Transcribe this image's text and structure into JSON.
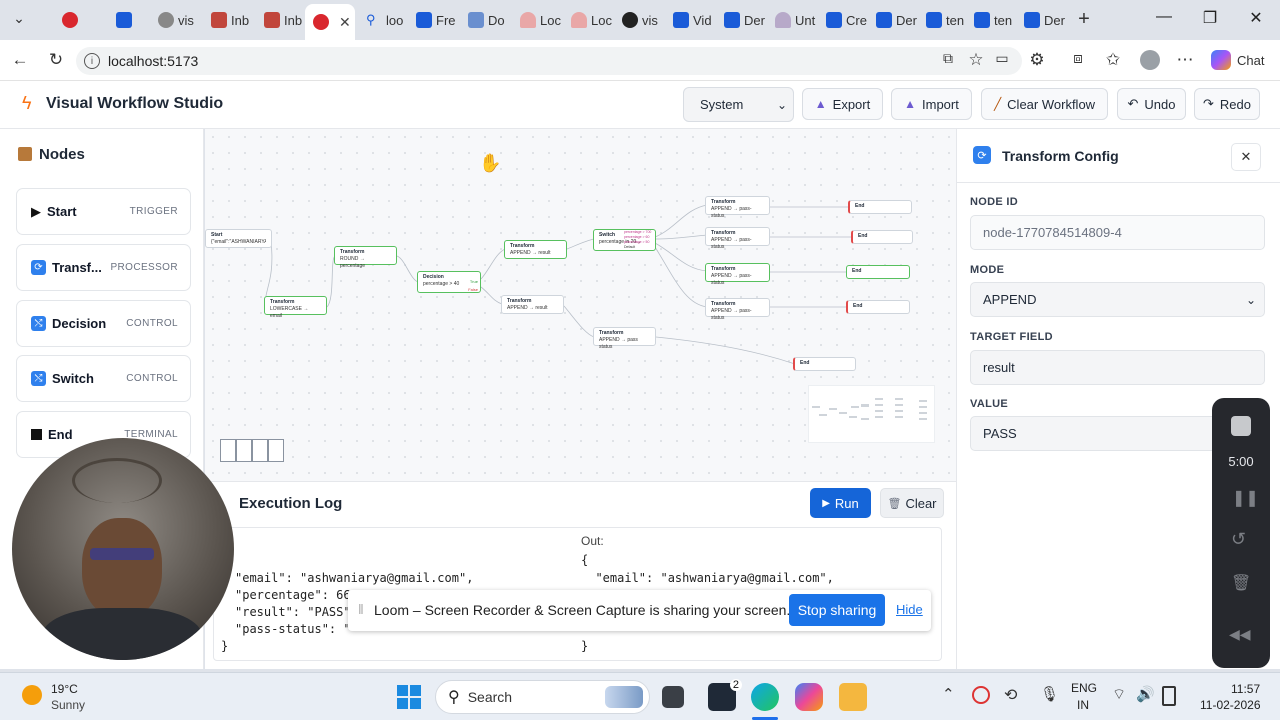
{
  "browser": {
    "tabs": [
      "vis",
      "Inb",
      "Inb",
      "",
      "loo",
      "Fre",
      "Do",
      "Loc",
      "Loc",
      "vis",
      "Vid",
      "Der",
      "Unt",
      "Cre",
      "Der",
      "ten",
      "ten",
      "Der"
    ],
    "url": "localhost:5173",
    "chat_label": "Chat"
  },
  "app": {
    "title": "Visual Workflow Studio",
    "mode_value": "System",
    "buttons": {
      "export": "Export",
      "import": "Import",
      "clear_workflow": "Clear Workflow",
      "undo": "Undo",
      "redo": "Redo"
    }
  },
  "sidebar": {
    "title": "Nodes",
    "items": [
      {
        "label": "Start",
        "category": "TRIGGER"
      },
      {
        "label": "Transf...",
        "category": "PROCESSOR"
      },
      {
        "label": "Decision",
        "category": "CONTROL"
      },
      {
        "label": "Switch",
        "category": "CONTROL"
      },
      {
        "label": "End",
        "category": "TERMINAL"
      }
    ]
  },
  "canvas": {
    "nodes": [
      {
        "title": "Start",
        "sub": "{\"email\":\"ASHWANIARYA@..."
      },
      {
        "title": "Transform",
        "sub": "LOWERCASE → email"
      },
      {
        "title": "Transform",
        "sub": "ROUND → percentage"
      },
      {
        "title": "Decision",
        "sub": "percentage > 40"
      },
      {
        "title": "Transform",
        "sub": "APPEND → result"
      },
      {
        "title": "Transform",
        "sub": "APPEND → result"
      },
      {
        "title": "Switch",
        "sub": "percentage in 20..."
      },
      {
        "title": "Transform",
        "sub": "APPEND → pass-status"
      },
      {
        "title": "Transform",
        "sub": "APPEND → pass-status"
      },
      {
        "title": "Transform",
        "sub": "APPEND → pass-status"
      },
      {
        "title": "Transform",
        "sub": "APPEND → pass-status"
      },
      {
        "title": "Transform",
        "sub": "APPEND → pass status"
      },
      {
        "title": "End",
        "sub": ""
      },
      {
        "title": "End",
        "sub": ""
      },
      {
        "title": "End",
        "sub": ""
      },
      {
        "title": "End",
        "sub": ""
      },
      {
        "title": "End",
        "sub": ""
      }
    ],
    "decision_true": "True",
    "decision_false": "False",
    "switch_cases": [
      "percentage > 700",
      "percentage > 60",
      "percentage > 50",
      "Default"
    ]
  },
  "log": {
    "title": "Execution Log",
    "run_label": "Run",
    "clear_label": "Clear",
    "left_lines": [
      "\"email\": \"ashwaniarya@gmail.com\",",
      "\"percentage\": 66",
      "\"result\": \"PASS\"",
      "\"pass-status\": \"",
      "}"
    ],
    "out_label": "Out:",
    "right_lines": [
      "{",
      "  \"email\": \"ashwaniarya@gmail.com\",",
      "}"
    ]
  },
  "config": {
    "title": "Transform Config",
    "node_id_label": "NODE ID",
    "node_id": "node-1770784514809-4",
    "mode_label": "MODE",
    "mode": "APPEND",
    "target_label": "TARGET FIELD",
    "target": "result",
    "value_label": "VALUE",
    "value": "PASS"
  },
  "loom": {
    "message": "Loom – Screen Recorder & Screen Capture is sharing your screen.",
    "stop": "Stop sharing",
    "hide": "Hide",
    "timer": "5:00"
  },
  "taskbar": {
    "temp": "19°C",
    "weather": "Sunny",
    "search": "Search",
    "lang1": "ENG",
    "lang2": "IN",
    "time": "11:57",
    "date": "11-02-2026",
    "badge": "2"
  }
}
